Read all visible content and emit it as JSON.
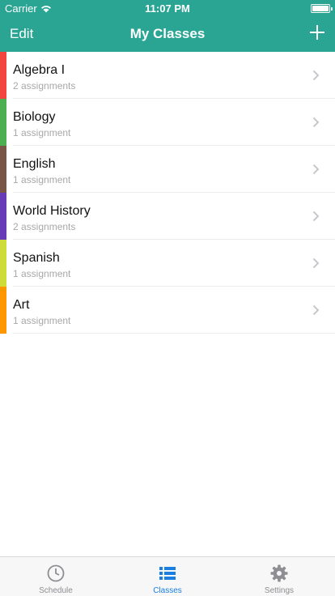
{
  "status_bar": {
    "carrier": "Carrier",
    "time": "11:07 PM"
  },
  "nav": {
    "edit_label": "Edit",
    "title": "My Classes",
    "add_icon": "plus-icon"
  },
  "classes": [
    {
      "name": "Algebra I",
      "subtitle": "2 assignments",
      "color": "#f2453d"
    },
    {
      "name": "Biology",
      "subtitle": "1 assignment",
      "color": "#4caf50"
    },
    {
      "name": "English",
      "subtitle": "1 assignment",
      "color": "#795548"
    },
    {
      "name": "World History",
      "subtitle": "2 assignments",
      "color": "#673ab7"
    },
    {
      "name": "Spanish",
      "subtitle": "1 assignment",
      "color": "#cddc39"
    },
    {
      "name": "Art",
      "subtitle": "1 assignment",
      "color": "#ff9800"
    }
  ],
  "tabs": [
    {
      "label": "Schedule",
      "icon": "clock-icon",
      "active": false
    },
    {
      "label": "Classes",
      "icon": "list-icon",
      "active": true
    },
    {
      "label": "Settings",
      "icon": "gear-icon",
      "active": false
    }
  ],
  "colors": {
    "header": "#2aa594",
    "tab_active": "#1a7fe0",
    "tab_inactive": "#8e8e93"
  }
}
